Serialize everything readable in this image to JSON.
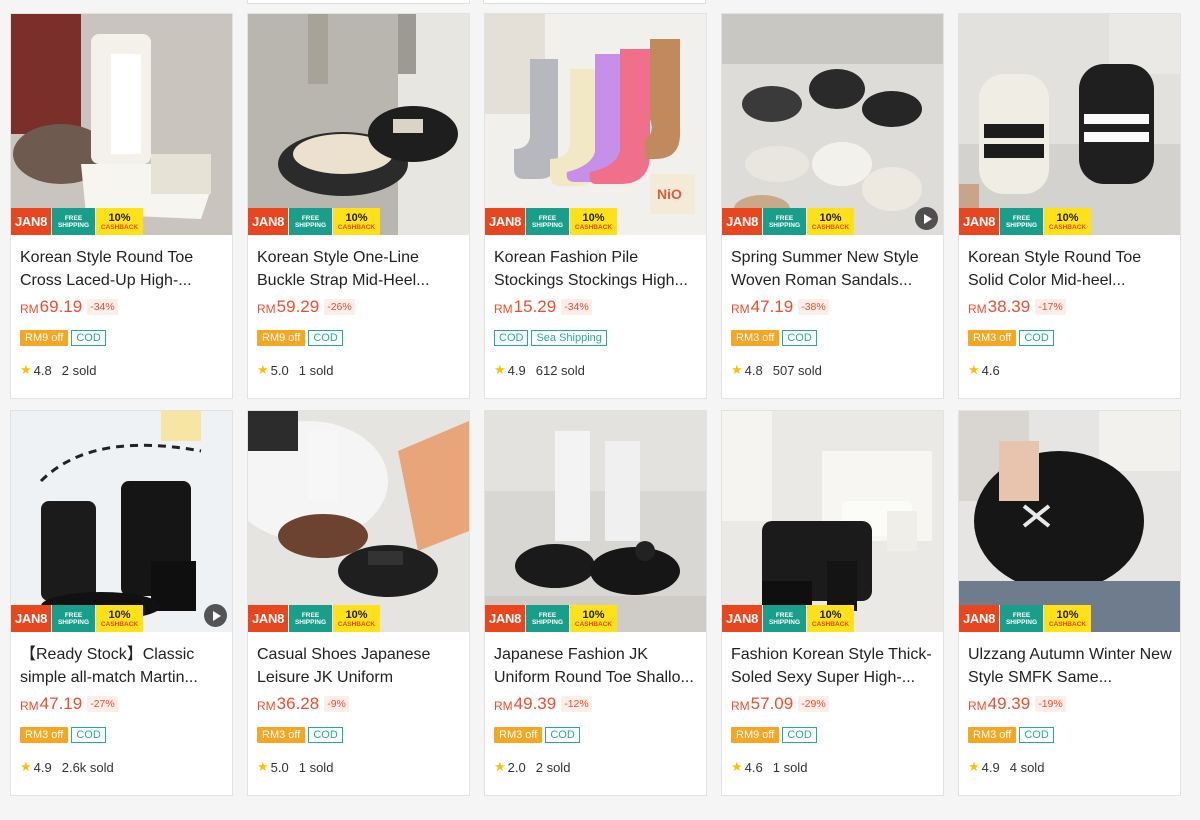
{
  "badges": {
    "jan": "JAN8",
    "free": "FREE",
    "shipping": "SHIPPING",
    "pct": "10%",
    "cashback": "CASHBACK"
  },
  "products": [
    {
      "title": "Korean Style Round Toe Cross Laced-Up High-...",
      "currency": "RM",
      "price": "69.19",
      "discount": "-34%",
      "tags": [
        "RM9 off",
        "COD"
      ],
      "rating": "4.8",
      "sold": "2 sold",
      "video": false
    },
    {
      "title": "Korean Style One-Line Buckle Strap Mid-Heel...",
      "currency": "RM",
      "price": "59.29",
      "discount": "-26%",
      "tags": [
        "RM9 off",
        "COD"
      ],
      "rating": "5.0",
      "sold": "1 sold",
      "video": false
    },
    {
      "title": "Korean Fashion Pile Stockings Stockings High...",
      "currency": "RM",
      "price": "15.29",
      "discount": "-34%",
      "tags": [
        "COD",
        "Sea Shipping"
      ],
      "rating": "4.9",
      "sold": "612 sold",
      "video": false
    },
    {
      "title": "Spring Summer New Style Woven Roman Sandals...",
      "currency": "RM",
      "price": "47.19",
      "discount": "-38%",
      "tags": [
        "RM3 off",
        "COD"
      ],
      "rating": "4.8",
      "sold": "507 sold",
      "video": true
    },
    {
      "title": "Korean Style Round Toe Solid Color Mid-heel...",
      "currency": "RM",
      "price": "38.39",
      "discount": "-17%",
      "tags": [
        "RM3 off",
        "COD"
      ],
      "rating": "4.6",
      "sold": "",
      "video": false
    },
    {
      "title": "【Ready Stock】Classic simple all-match Martin...",
      "currency": "RM",
      "price": "47.19",
      "discount": "-27%",
      "tags": [
        "RM3 off",
        "COD"
      ],
      "rating": "4.9",
      "sold": "2.6k sold",
      "video": true
    },
    {
      "title": "Casual Shoes Japanese Leisure JK Uniform",
      "currency": "RM",
      "price": "36.28",
      "discount": "-9%",
      "tags": [
        "RM3 off",
        "COD"
      ],
      "rating": "5.0",
      "sold": "1 sold",
      "video": false
    },
    {
      "title": "Japanese Fashion JK Uniform Round Toe Shallo...",
      "currency": "RM",
      "price": "49.39",
      "discount": "-12%",
      "tags": [
        "RM3 off",
        "COD"
      ],
      "rating": "2.0",
      "sold": "2 sold",
      "video": false
    },
    {
      "title": "Fashion Korean Style Thick-Soled Sexy Super High-...",
      "currency": "RM",
      "price": "57.09",
      "discount": "-29%",
      "tags": [
        "RM9 off",
        "COD"
      ],
      "rating": "4.6",
      "sold": "1 sold",
      "video": false
    },
    {
      "title": "Ulzzang Autumn Winter New Style SMFK Same...",
      "currency": "RM",
      "price": "49.39",
      "discount": "-19%",
      "tags": [
        "RM3 off",
        "COD"
      ],
      "rating": "4.9",
      "sold": "4 sold",
      "video": false
    }
  ],
  "colors": {
    "price": "#ee4d2d",
    "cod": "#26aa99",
    "voucher": "#f5a623",
    "star": "#ffbf00"
  },
  "icons": {
    "rating": "star-icon",
    "video": "play-icon"
  }
}
